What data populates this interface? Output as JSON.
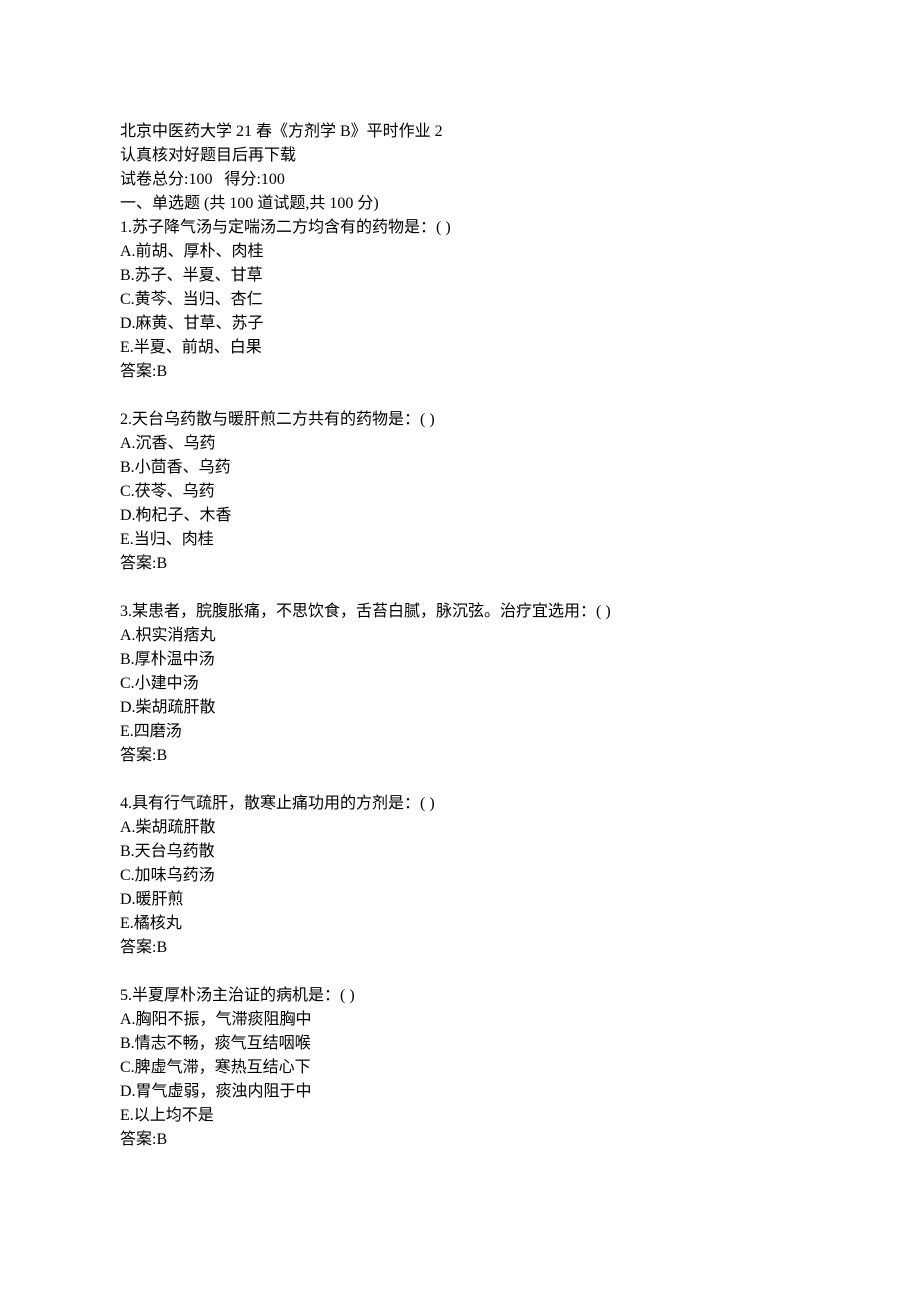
{
  "header": {
    "title": "北京中医药大学 21 春《方剂学 B》平时作业 2",
    "note": "认真核对好题目后再下载",
    "score_line": "试卷总分:100   得分:100",
    "section_heading": "一、单选题 (共 100 道试题,共 100 分)"
  },
  "questions": [
    {
      "stem": "1.苏子降气汤与定喘汤二方均含有的药物是：( )",
      "options": [
        "A.前胡、厚朴、肉桂",
        "B.苏子、半夏、甘草",
        "C.黄芩、当归、杏仁",
        "D.麻黄、甘草、苏子",
        "E.半夏、前胡、白果"
      ],
      "answer": "答案:B"
    },
    {
      "stem": "2.天台乌药散与暖肝煎二方共有的药物是：( )",
      "options": [
        "A.沉香、乌药",
        "B.小茴香、乌药",
        "C.茯苓、乌药",
        "D.枸杞子、木香",
        "E.当归、肉桂"
      ],
      "answer": "答案:B"
    },
    {
      "stem": "3.某患者，脘腹胀痛，不思饮食，舌苔白腻，脉沉弦。治疗宜选用：( )",
      "options": [
        "A.枳实消痞丸",
        "B.厚朴温中汤",
        "C.小建中汤",
        "D.柴胡疏肝散",
        "E.四磨汤"
      ],
      "answer": "答案:B"
    },
    {
      "stem": "4.具有行气疏肝，散寒止痛功用的方剂是：( )",
      "options": [
        "A.柴胡疏肝散",
        "B.天台乌药散",
        "C.加味乌药汤",
        "D.暖肝煎",
        "E.橘核丸"
      ],
      "answer": "答案:B"
    },
    {
      "stem": "5.半夏厚朴汤主治证的病机是：( )",
      "options": [
        "A.胸阳不振，气滞痰阻胸中",
        "B.情志不畅，痰气互结咽喉",
        "C.脾虚气滞，寒热互结心下",
        "D.胃气虚弱，痰浊内阻于中",
        "E.以上均不是"
      ],
      "answer": "答案:B"
    }
  ]
}
